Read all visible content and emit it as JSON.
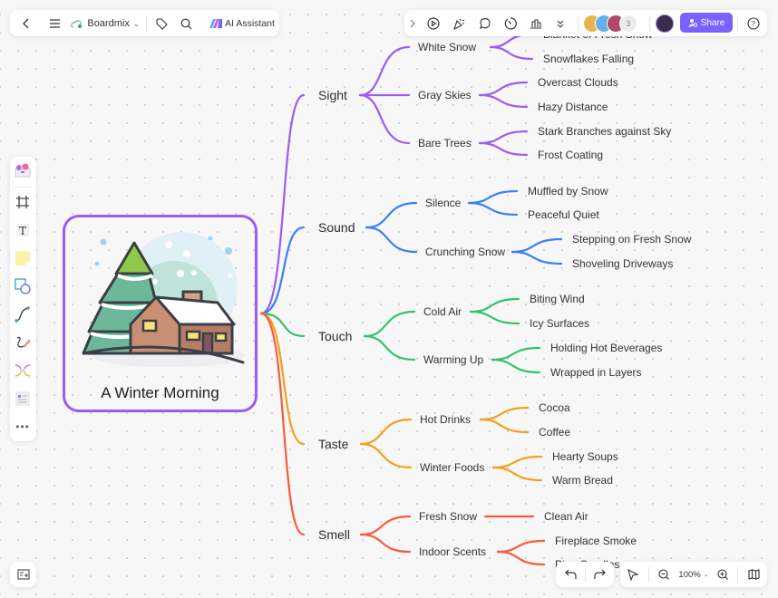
{
  "top_left_toolbar": {
    "back_icon": "chevron-left-icon",
    "menu_icon": "hamburger-icon",
    "board_name": "Boardmix",
    "tag_icon": "tag-icon",
    "search_icon": "search-icon",
    "ai_label": "AI Assistant"
  },
  "top_right_toolbar": {
    "icons": [
      "chevron-right-icon",
      "play-icon",
      "celebrate-icon",
      "comment-icon",
      "timer-icon",
      "vote-icon",
      "more-chevrons-icon"
    ],
    "collaborator_count": "3",
    "share_label": "Share",
    "help_icon": "help-icon"
  },
  "left_toolbar": {
    "tools": [
      "templates",
      "frame",
      "text",
      "sticky-note",
      "shape",
      "connector",
      "pen",
      "mindmap",
      "more-templates",
      "more"
    ]
  },
  "bottom_toolbar": {
    "zoom_level": "100%",
    "undo_icon": "undo-icon",
    "redo_icon": "redo-icon"
  },
  "mindmap": {
    "root": "A Winter Morning",
    "branches": [
      {
        "label": "Sight",
        "color": "#9b5cf0",
        "children": [
          {
            "label": "White Snow",
            "leaves": [
              "Blanket of Fresh Snow",
              "Snowflakes Falling"
            ]
          },
          {
            "label": "Gray Skies",
            "leaves": [
              "Overcast Clouds",
              "Hazy Distance"
            ]
          },
          {
            "label": "Bare Trees",
            "leaves": [
              "Stark Branches against Sky",
              "Frost Coating"
            ]
          }
        ]
      },
      {
        "label": "Sound",
        "color": "#3d7ef5",
        "children": [
          {
            "label": "Silence",
            "leaves": [
              "Muffled by Snow",
              "Peaceful Quiet"
            ]
          },
          {
            "label": "Crunching Snow",
            "leaves": [
              "Stepping on Fresh Snow",
              "Shoveling Driveways"
            ]
          }
        ]
      },
      {
        "label": "Touch",
        "color": "#33c26e",
        "children": [
          {
            "label": "Cold Air",
            "leaves": [
              "Biting Wind",
              "Icy Surfaces"
            ]
          },
          {
            "label": "Warming Up",
            "leaves": [
              "Holding Hot Beverages",
              "Wrapped in Layers"
            ]
          }
        ]
      },
      {
        "label": "Taste",
        "color": "#f2a01f",
        "children": [
          {
            "label": "Hot Drinks",
            "leaves": [
              "Cocoa",
              "Coffee"
            ]
          },
          {
            "label": "Winter Foods",
            "leaves": [
              "Hearty Soups",
              "Warm Bread"
            ]
          }
        ]
      },
      {
        "label": "Smell",
        "color": "#fb5a3c",
        "children": [
          {
            "label": "Fresh Snow",
            "leaves": [
              "Clean Air"
            ]
          },
          {
            "label": "Indoor Scents",
            "leaves": [
              "Fireplace Smoke",
              "Pine Candles"
            ]
          }
        ]
      }
    ]
  }
}
